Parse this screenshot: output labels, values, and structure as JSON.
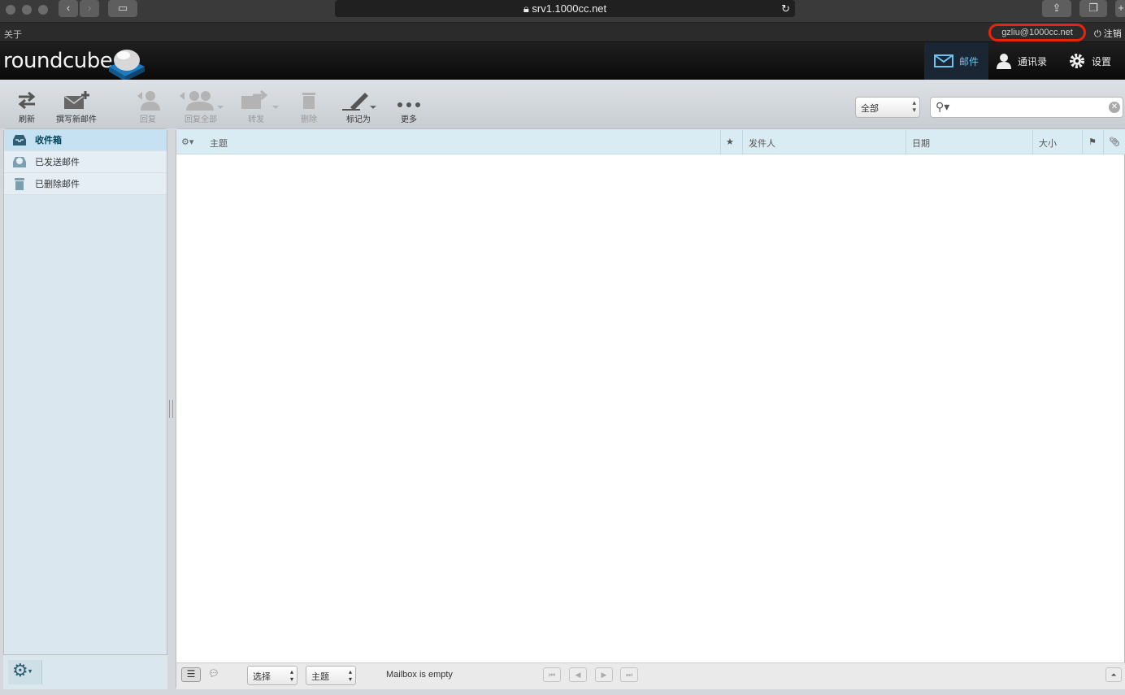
{
  "browser": {
    "url": "srv1.1000cc.net"
  },
  "topline": {
    "about": "关于",
    "username": "gzliu@1000cc.net",
    "logout": "注销"
  },
  "header": {
    "logo": "roundcube",
    "nav": {
      "mail": "邮件",
      "contacts": "通讯录",
      "settings": "设置"
    }
  },
  "toolbar": {
    "refresh": "刷新",
    "compose": "撰写新邮件",
    "reply": "回复",
    "reply_all": "回复全部",
    "forward": "转发",
    "delete": "删除",
    "mark": "标记为",
    "more": "更多",
    "filter": "全部",
    "search_placeholder": ""
  },
  "folders": [
    {
      "label": "收件箱",
      "icon": "inbox-icon",
      "selected": true
    },
    {
      "label": "已发送邮件",
      "icon": "sent-icon",
      "selected": false
    },
    {
      "label": "已删除邮件",
      "icon": "trash-icon",
      "selected": false
    }
  ],
  "list": {
    "columns": {
      "subject": "主题",
      "from": "发件人",
      "date": "日期",
      "size": "大小"
    },
    "footer": {
      "select": "选择",
      "threads": "主题",
      "status": "Mailbox is empty"
    }
  }
}
